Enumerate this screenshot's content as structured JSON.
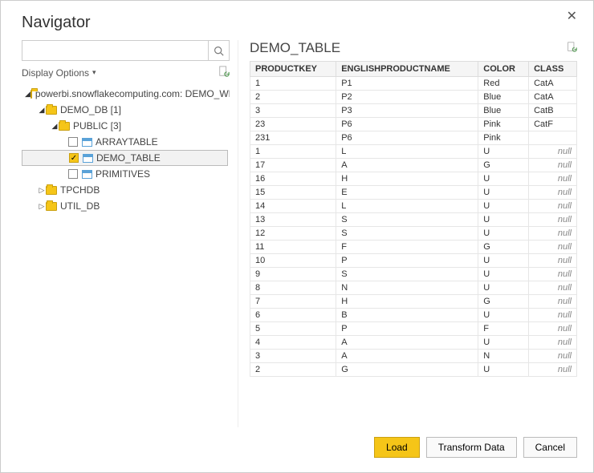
{
  "dialog": {
    "title": "Navigator"
  },
  "search": {
    "placeholder": ""
  },
  "options": {
    "label": "Display Options"
  },
  "tree": {
    "root": {
      "label": "powerbi.snowflakecomputing.com: DEMO_WH..."
    },
    "db": {
      "label": "DEMO_DB [1]"
    },
    "schema": {
      "label": "PUBLIC [3]"
    },
    "tables": {
      "t0": "ARRAYTABLE",
      "t1": "DEMO_TABLE",
      "t2": "PRIMITIVES"
    },
    "other": {
      "o0": "TPCHDB",
      "o1": "UTIL_DB"
    }
  },
  "preview": {
    "title": "DEMO_TABLE",
    "columns": {
      "c0": "PRODUCTKEY",
      "c1": "ENGLISHPRODUCTNAME",
      "c2": "COLOR",
      "c3": "CLASS"
    },
    "null_text": "null",
    "rows": [
      {
        "c0": "1",
        "c1": "P1",
        "c2": "Red",
        "c3": "CatA"
      },
      {
        "c0": "2",
        "c1": "P2",
        "c2": "Blue",
        "c3": "CatA"
      },
      {
        "c0": "3",
        "c1": "P3",
        "c2": "Blue",
        "c3": "CatB"
      },
      {
        "c0": "23",
        "c1": "P6",
        "c2": "Pink",
        "c3": "CatF"
      },
      {
        "c0": "231",
        "c1": "P6",
        "c2": "Pink",
        "c3": ""
      },
      {
        "c0": "1",
        "c1": "L",
        "c2": "U",
        "c3": null
      },
      {
        "c0": "17",
        "c1": "A",
        "c2": "G",
        "c3": null
      },
      {
        "c0": "16",
        "c1": "H",
        "c2": "U",
        "c3": null
      },
      {
        "c0": "15",
        "c1": "E",
        "c2": "U",
        "c3": null
      },
      {
        "c0": "14",
        "c1": "L",
        "c2": "U",
        "c3": null
      },
      {
        "c0": "13",
        "c1": "S",
        "c2": "U",
        "c3": null
      },
      {
        "c0": "12",
        "c1": "S",
        "c2": "U",
        "c3": null
      },
      {
        "c0": "11",
        "c1": "F",
        "c2": "G",
        "c3": null
      },
      {
        "c0": "10",
        "c1": "P",
        "c2": "U",
        "c3": null
      },
      {
        "c0": "9",
        "c1": "S",
        "c2": "U",
        "c3": null
      },
      {
        "c0": "8",
        "c1": "N",
        "c2": "U",
        "c3": null
      },
      {
        "c0": "7",
        "c1": "H",
        "c2": "G",
        "c3": null
      },
      {
        "c0": "6",
        "c1": "B",
        "c2": "U",
        "c3": null
      },
      {
        "c0": "5",
        "c1": "P",
        "c2": "F",
        "c3": null
      },
      {
        "c0": "4",
        "c1": "A",
        "c2": "U",
        "c3": null
      },
      {
        "c0": "3",
        "c1": "A",
        "c2": "N",
        "c3": null
      },
      {
        "c0": "2",
        "c1": "G",
        "c2": "U",
        "c3": null
      }
    ]
  },
  "footer": {
    "load": "Load",
    "transform": "Transform Data",
    "cancel": "Cancel"
  }
}
